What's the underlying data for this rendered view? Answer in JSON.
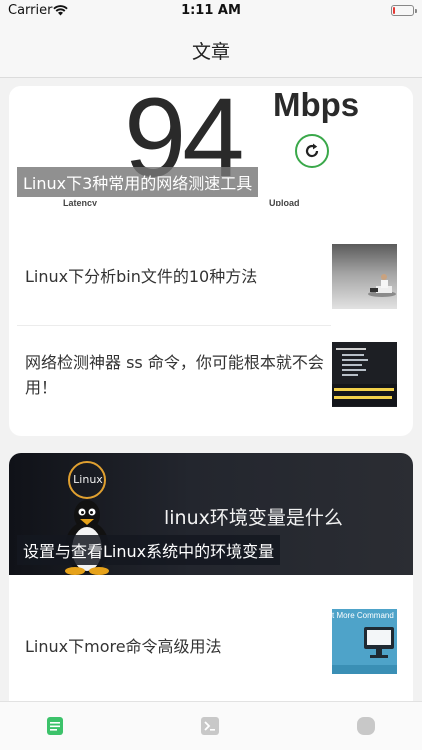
{
  "status_bar": {
    "carrier": "Carrier",
    "time": "1:11 AM",
    "battery_level_pct": 10,
    "battery_color": "#e53935"
  },
  "nav": {
    "title": "文章"
  },
  "card_1": {
    "hero": {
      "speed_value": "94",
      "speed_unit": "Mbps",
      "latency_label": "Latency",
      "upload_label": "Upload",
      "refresh_icon": "refresh-icon",
      "accent": "#3aa84a",
      "caption": "Linux下3种常用的网络测速工具"
    },
    "rows": [
      {
        "title": "Linux下分析bin文件的10种方法",
        "thumb_icon": "person-on-laptop-photo"
      },
      {
        "title": "网络检测神器 ss 命令，你可能根本就不会用！",
        "thumb_icon": "terminal-screenshot"
      }
    ]
  },
  "card_2": {
    "hero": {
      "heading": "linux环境变量是什么",
      "badge": "Linux",
      "caption": "设置与查看Linux系统中的环境变量"
    },
    "rows": [
      {
        "title": "Linux下more命令高级用法",
        "thumb_text": "t More Command",
        "thumb_icon": "monitor-illustration"
      }
    ]
  },
  "tabs": [
    {
      "icon": "document-icon",
      "active": true,
      "color": "#3cc26a"
    },
    {
      "icon": "terminal-icon",
      "active": false,
      "color": "#c8c8c8"
    },
    {
      "icon": "circle-icon",
      "active": false,
      "color": "#c8c8c8"
    }
  ]
}
